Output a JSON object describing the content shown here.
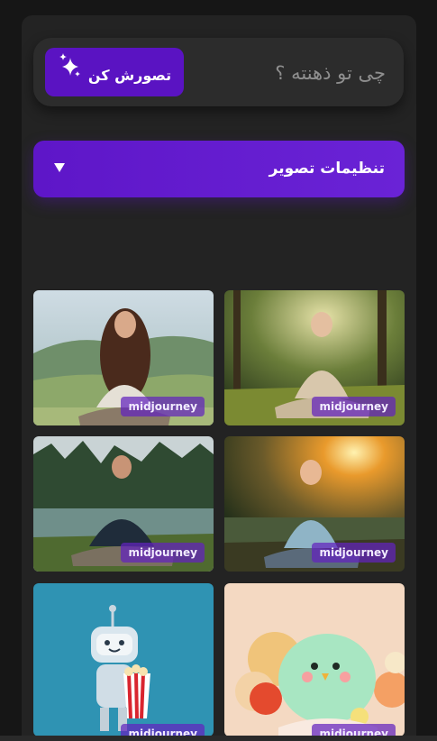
{
  "prompt": {
    "placeholder": "چی تو ذهنته ؟",
    "value": ""
  },
  "imagine_button": {
    "label": "تصورش کن",
    "icon": "sparkle-icon"
  },
  "settings": {
    "title": "تنظیمات تصویر",
    "icon": "chevron-down-icon",
    "expanded": false
  },
  "gallery": {
    "cards": [
      {
        "badge": "midjourney",
        "subject": "woman-meditating-hills"
      },
      {
        "badge": "midjourney",
        "subject": "woman-meditating-forest"
      },
      {
        "badge": "midjourney",
        "subject": "man-meditating-lake"
      },
      {
        "badge": "midjourney",
        "subject": "woman-meditating-sunset"
      },
      {
        "badge": "midjourney",
        "subject": "robot-popcorn"
      },
      {
        "badge": "midjourney",
        "subject": "green-bird-3d"
      }
    ]
  },
  "colors": {
    "background": "#161616",
    "panel": "#232323",
    "accent": "#5a13c2",
    "badge": "#6222be"
  }
}
